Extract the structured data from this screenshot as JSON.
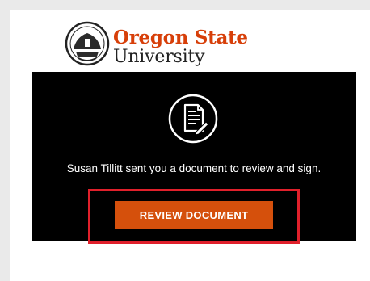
{
  "brand": {
    "name_line1": "Oregon State",
    "name_line2": "University",
    "primary_color": "#d73f09"
  },
  "notification": {
    "icon": "document-sign-icon",
    "message": "Susan Tillitt sent you a document to review and sign.",
    "button_label": "REVIEW DOCUMENT",
    "button_color": "#d5500c",
    "panel_color": "#000000",
    "highlight_color": "#e0202b"
  }
}
